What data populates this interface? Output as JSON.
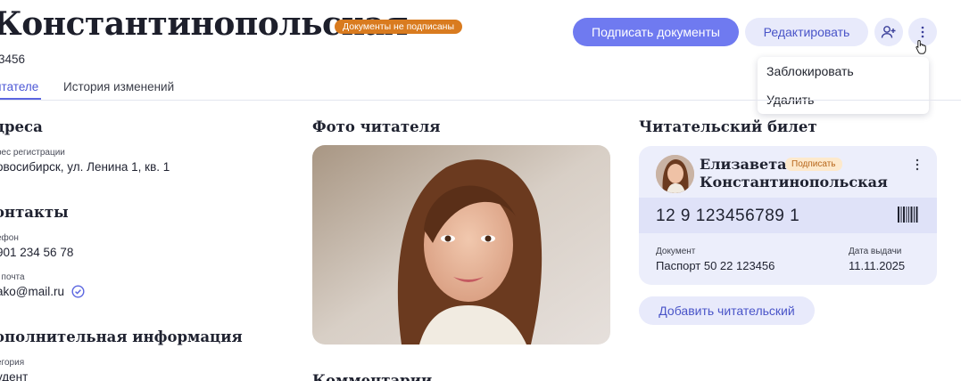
{
  "header": {
    "name": "Константинопольская",
    "status_badge": "Документы не подписаны",
    "reader_id": "3456",
    "sign_button": "Подписать документы",
    "edit_button": "Редактировать"
  },
  "dropdown": {
    "items": [
      "Заблокировать",
      "Удалить"
    ]
  },
  "tabs": {
    "readers": "итателе",
    "history": "История изменений"
  },
  "addresses": {
    "title": "дреса",
    "reg_label": "рес регистрации",
    "reg_value": "овосибирск, ул. Ленина 1, кв. 1"
  },
  "contacts": {
    "title": "онтакты",
    "phone_label": "ефон",
    "phone_value": "901 234 56 78",
    "email_label": ". почта",
    "email_value": "ako@mail.ru"
  },
  "extra": {
    "title": "ополнительная информация",
    "category_label": "егория",
    "category_value": "удент"
  },
  "photo": {
    "title": "Фото читателя"
  },
  "comments": {
    "title": "Комментарии"
  },
  "library_card": {
    "title": "Читательский билет",
    "first_name": "Елизавета",
    "last_name": "Константинопольская",
    "badge": "Подписать",
    "number": "12 9 123456789 1",
    "doc_label": "Документ",
    "doc_value": "Паспорт 50 22 123456",
    "date_label": "Дата выдачи",
    "date_value": "11.11.2025",
    "add_button": "Добавить читательский"
  },
  "colors": {
    "accent": "#6f7af0",
    "accent_light": "#e8eafb",
    "status_orange": "#d97b1f",
    "verified_blue": "#5b66e0"
  },
  "icons": [
    "add-person-icon",
    "more-vertical-icon",
    "hand-cursor-icon",
    "verified-check-icon",
    "barcode-icon"
  ]
}
